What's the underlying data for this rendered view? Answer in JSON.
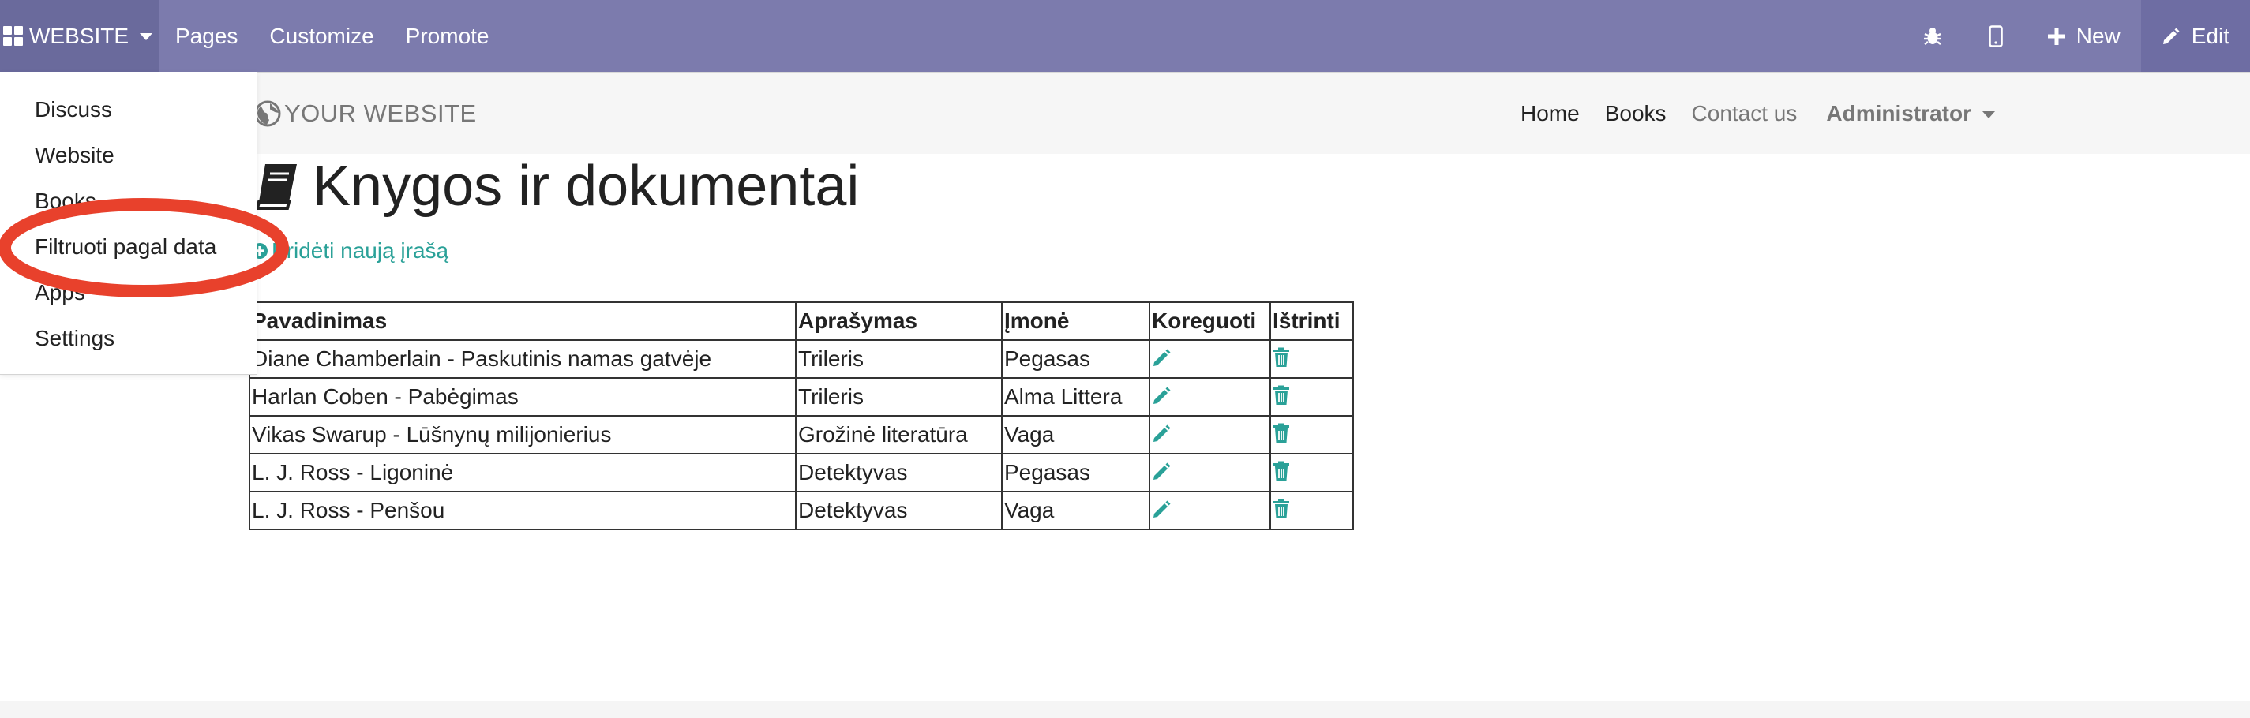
{
  "topbar": {
    "apps_label": "WEBSITE",
    "menu": [
      "Pages",
      "Customize",
      "Promote"
    ],
    "new_label": "New",
    "edit_label": "Edit",
    "icons": [
      "bug-icon",
      "mobile-icon",
      "plus-icon",
      "pencil-icon"
    ]
  },
  "dropdown": {
    "items": [
      "Discuss",
      "Website",
      "Books",
      "Filtruoti pagal data",
      "Apps",
      "Settings"
    ]
  },
  "site": {
    "logo_text": "YOUR WEBSITE",
    "nav": [
      "Home",
      "Books",
      "Contact us"
    ],
    "user": "Administrator"
  },
  "main": {
    "title": "Knygos ir dokumentai",
    "add_link": "Pridėti naują įrašą",
    "columns": [
      "Pavadinimas",
      "Aprašymas",
      "Įmonė",
      "Koreguoti",
      "Ištrinti"
    ],
    "rows": [
      [
        "Diane Chamberlain - Paskutinis namas gatvėje",
        "Trileris",
        "Pegasas"
      ],
      [
        "Harlan Coben - Pabėgimas",
        "Trileris",
        "Alma Littera"
      ],
      [
        "Vikas Swarup - Lūšnynų milijonierius",
        "Grožinė literatūra",
        "Vaga"
      ],
      [
        "L. J. Ross - Ligoninė",
        "Detektyvas",
        "Pegasas"
      ],
      [
        "L. J. Ross - Penšou",
        "Detektyvas",
        "Vaga"
      ]
    ]
  },
  "colors": {
    "topbar": "#7c7bad",
    "accent": "#2aa198",
    "annotation": "#e8412c"
  }
}
